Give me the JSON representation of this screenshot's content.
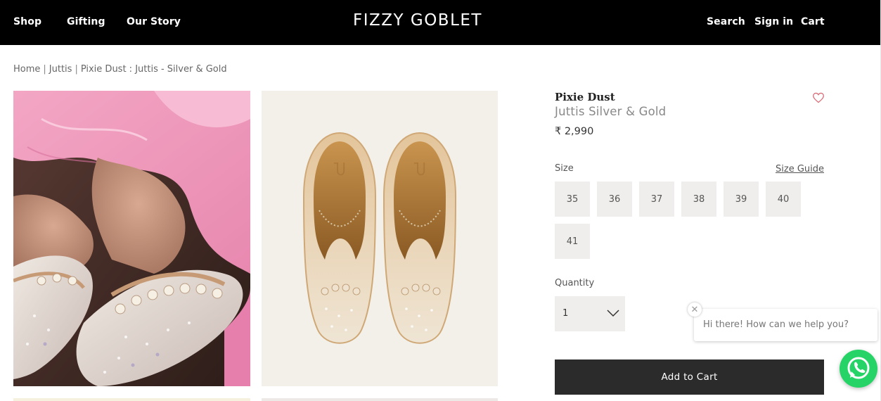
{
  "header": {
    "nav_left": [
      "Shop",
      "Gifting",
      "Our Story"
    ],
    "brand": "FIZZY GOBLET",
    "nav_right": [
      "Search",
      "Sign in",
      "Cart"
    ]
  },
  "breadcrumb": {
    "items": [
      "Home",
      "Juttis",
      "Pixie Dust : Juttis - Silver & Gold"
    ],
    "separator": "|"
  },
  "product": {
    "title": "Pixie Dust",
    "subtitle": "Juttis Silver & Gold",
    "price": "₹ 2,990",
    "wishlist_icon": "heart-icon"
  },
  "size": {
    "label": "Size",
    "guide_label": "Size Guide",
    "options": [
      "35",
      "36",
      "37",
      "38",
      "39",
      "40",
      "41"
    ]
  },
  "quantity": {
    "label": "Quantity",
    "value": "1",
    "icon": "chevron-down-icon"
  },
  "add_to_cart": "Add to Cart",
  "chat": {
    "message": "Hi there! How can we help you?",
    "close_icon": "close-icon",
    "whatsapp_icon": "whatsapp-icon"
  },
  "colors": {
    "header_bg": "#000000",
    "button_dark": "#2b2b2b",
    "size_bg": "#f0eeec",
    "wishlist": "#d9707a",
    "whatsapp": "#25d366",
    "image_right_bg": "#f3f0ea"
  }
}
